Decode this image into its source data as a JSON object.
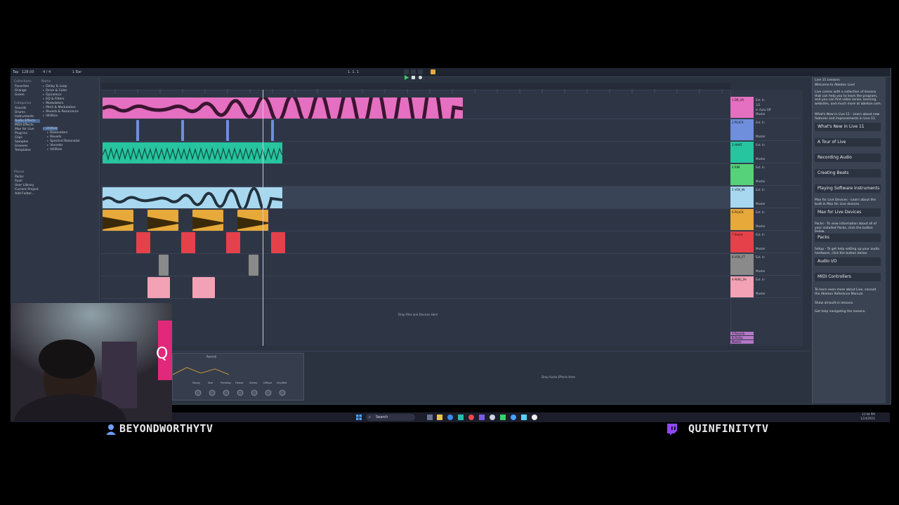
{
  "toolbar": {
    "tempo": "128.00",
    "signature": "4 / 4",
    "bar_setting": "1 Bar",
    "position": "1. 1. 1"
  },
  "browser": {
    "collections_header": "Collections",
    "collections": [
      "Favorites",
      "Orange",
      "Green"
    ],
    "categories_header": "Categories",
    "categories": [
      "Sounds",
      "Drums",
      "Instruments",
      "Audio Effects",
      "MIDI Effects",
      "Max for Live",
      "Plug-Ins",
      "Clips",
      "Samples",
      "Grooves",
      "Templates"
    ],
    "places_header": "Places",
    "places": [
      "Packs",
      "Push",
      "User Library",
      "Current Project",
      "Add Folder..."
    ],
    "name_header": "Name",
    "folders": [
      "Delay & Loop",
      "Drive & Color",
      "Dynamics",
      "EQ & Filters",
      "Modulators",
      "Pitch & Modulation",
      "Reverb & Resonance",
      "Utilities",
      "Resonators",
      "Reverb",
      "Spectral Resonator",
      "Vocoder",
      "Utilities"
    ]
  },
  "tracks": [
    {
      "name": "1 DR_VX",
      "color": "#e56fc0"
    },
    {
      "name": "2 PLUCK",
      "color": "#6f8fdc"
    },
    {
      "name": "3 HHAT",
      "color": "#27c4a0"
    },
    {
      "name": "4 RIM",
      "color": "#55d27a"
    },
    {
      "name": "5 VOX_IN",
      "color": "#a8d8f0"
    },
    {
      "name": "6 PLUCK",
      "color": "#e7a93a"
    },
    {
      "name": "7 Snare",
      "color": "#e5414b"
    },
    {
      "name": "8 VOX_FT",
      "color": "#8a8a8a"
    },
    {
      "name": "9 PERC_Pe",
      "color": "#f2a2b4"
    }
  ],
  "mixer_labels": {
    "audio_from": "Ext. In",
    "channel": "1/2",
    "monitor": "In Auto Off",
    "output": "Master"
  },
  "returns": [
    "A Reverb",
    "B Delay",
    "Master"
  ],
  "arrangement": {
    "drop_files_hint": "Drop Files and Devices Here"
  },
  "device_view": {
    "drop_effects_hint": "Drop Audio Effects Here",
    "device_name": "Reverb",
    "params": [
      "Decay",
      "Size",
      "Predelay",
      "Freeze",
      "Stereo",
      "Diffuse",
      "Dry/Wet"
    ]
  },
  "info_view": {
    "title": "Live 11 Lessons",
    "welcome": "Welcome to Ableton Live!",
    "intro": "Live comes with a collection of lessons that can help you to learn the program, and you can find video series, learning websites, and much more at ableton.com.",
    "whats_new_intro": "What's New in Live 11 - Learn about new features and improvements in Live 11.",
    "lessons": [
      "What's New in Live 11",
      "A Tour of Live",
      "Recording Audio",
      "Creating Beats",
      "Playing Software Instruments"
    ],
    "m4l_intro": "Max for Live Devices - Learn about the built-in Max for Live devices.",
    "m4l_button": "Max for Live Devices",
    "packs_intro": "Packs - To view information about all of your installed Packs, click the button below.",
    "packs_button": "Packs",
    "setup_intro": "Setup - To get help setting up your audio hardware, click the button below.",
    "setup_buttons": [
      "Audio I/O",
      "MIDI Controllers"
    ],
    "outro": "To learn even more about Live, consult the Ableton Reference Manual.",
    "show_all": "Show all built-in lessons.",
    "nav_help": "Get help navigating the lessons."
  },
  "taskbar": {
    "search_placeholder": "Search",
    "time": "12:04 PM",
    "date": "1/24/2023"
  },
  "overlay": {
    "left_name": "BEYONDWORTHYTV",
    "right_name": "QUINFINITYTV",
    "cam_logo_letter": "Q"
  },
  "colors": {
    "accent_twitch": "#9147ff"
  }
}
